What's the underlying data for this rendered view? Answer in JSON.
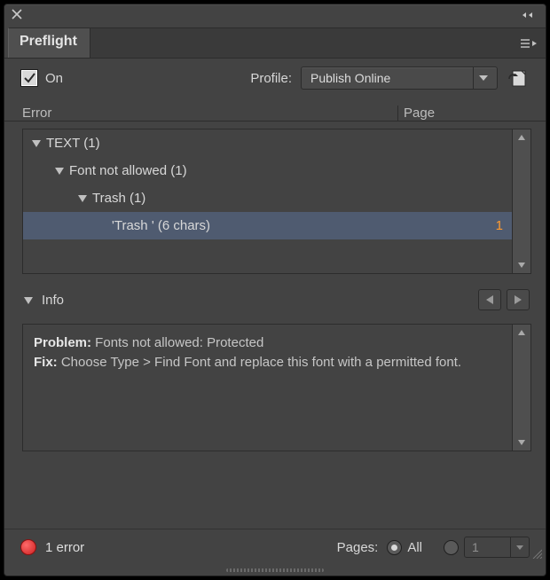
{
  "panel": {
    "tab": "Preflight"
  },
  "controls": {
    "on_label": "On",
    "profile_label": "Profile:",
    "profile_value": "Publish Online"
  },
  "columns": {
    "error": "Error",
    "page": "Page"
  },
  "tree": {
    "r0": "TEXT (1)",
    "r1": "Font not allowed (1)",
    "r2": "Trash (1)",
    "r3": "'Trash ' (6 chars)",
    "r3_page": "1"
  },
  "info": {
    "header": "Info",
    "problem_label": "Problem:",
    "problem_text": " Fonts not allowed: Protected",
    "fix_label": "Fix:",
    "fix_text": " Choose Type > Find Font and replace this font with a permitted font."
  },
  "footer": {
    "status": "1 error",
    "pages_label": "Pages:",
    "all_label": "All",
    "range_value": "1"
  }
}
